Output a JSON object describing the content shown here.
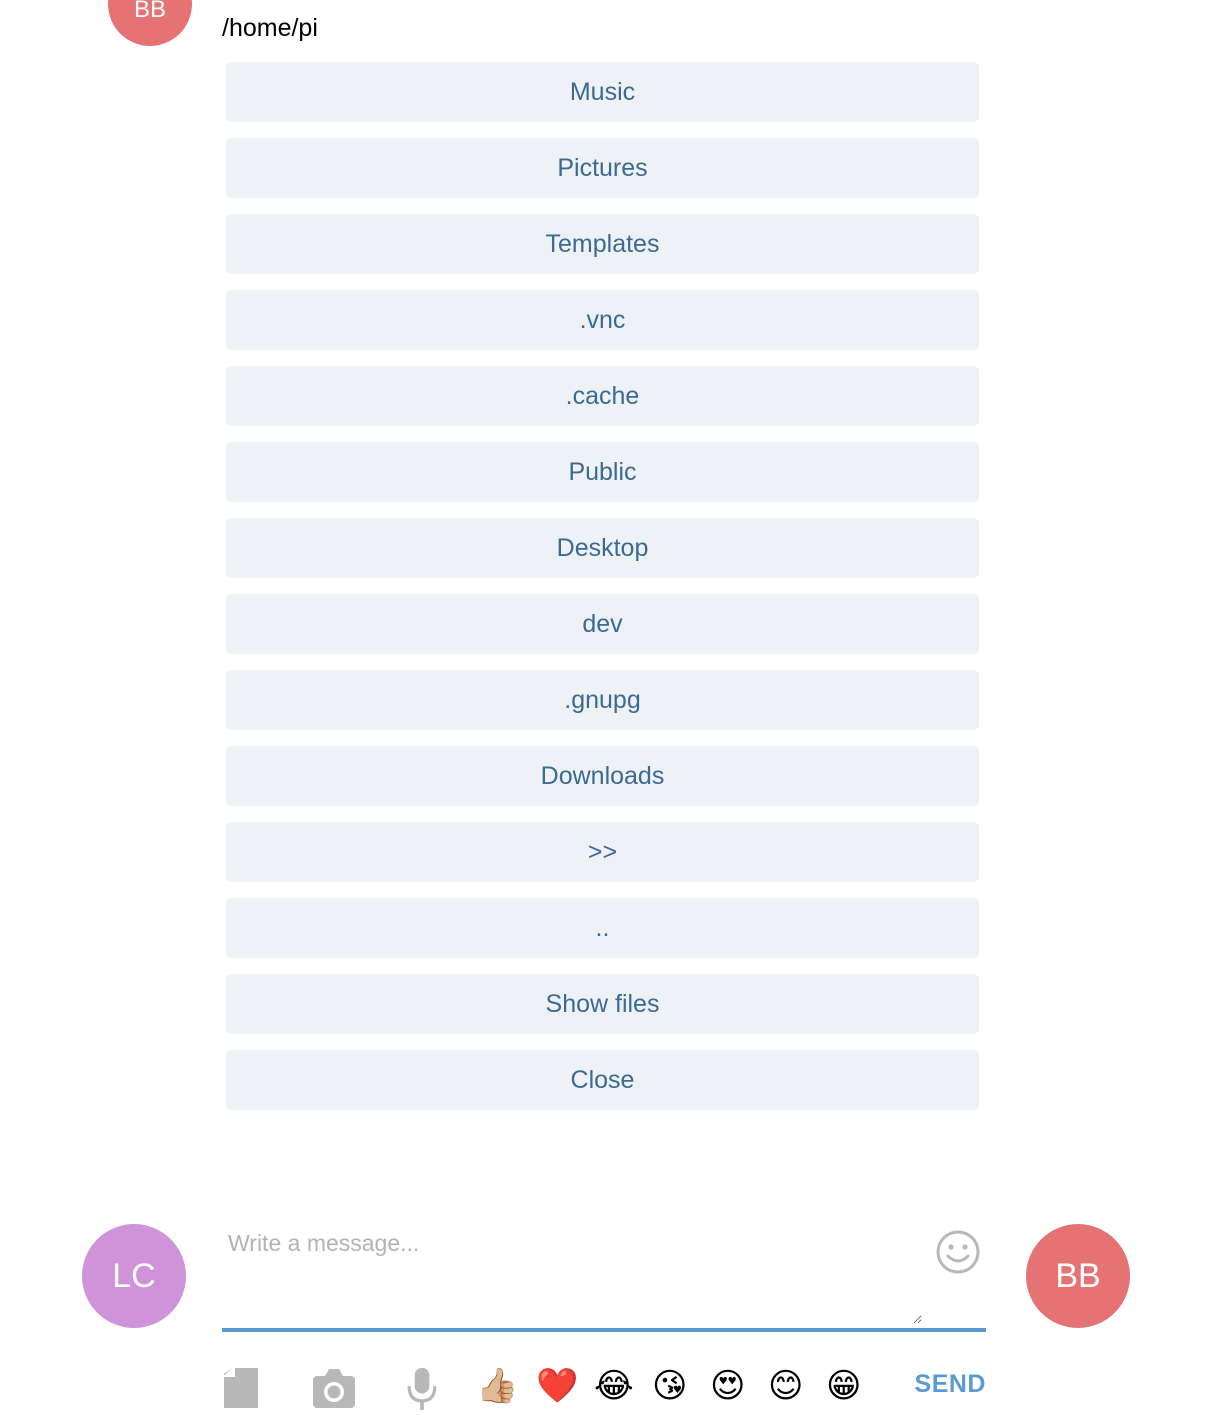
{
  "colors": {
    "button_bg": "#eef2f6",
    "button_text": "#3b6a92",
    "avatar_bb": "#e57373",
    "avatar_lc": "#ce93d8",
    "accent": "#5b9bd5",
    "icon_gray": "#b8b8b8"
  },
  "chat": {
    "sender_avatar": "BB",
    "message_text": "/home/pi"
  },
  "directory_buttons": [
    {
      "label": "Music"
    },
    {
      "label": "Pictures"
    },
    {
      "label": "Templates"
    },
    {
      "label": ".vnc"
    },
    {
      "label": ".cache"
    },
    {
      "label": "Public"
    },
    {
      "label": "Desktop"
    },
    {
      "label": "dev"
    },
    {
      "label": ".gnupg"
    },
    {
      "label": "Downloads"
    },
    {
      "label": ">>"
    },
    {
      "label": ".."
    },
    {
      "label": "Show files"
    },
    {
      "label": "Close"
    }
  ],
  "composer": {
    "left_avatar": "LC",
    "right_avatar": "BB",
    "placeholder": "Write a message...",
    "smiley_icon": "smiley-icon"
  },
  "toolbar": {
    "icons": [
      "file-icon",
      "camera-icon",
      "microphone-icon"
    ],
    "emojis": [
      "👍🏼",
      "❤️",
      "😂",
      "😘",
      "😍",
      "😊",
      "😁"
    ],
    "send_label": "SEND"
  }
}
